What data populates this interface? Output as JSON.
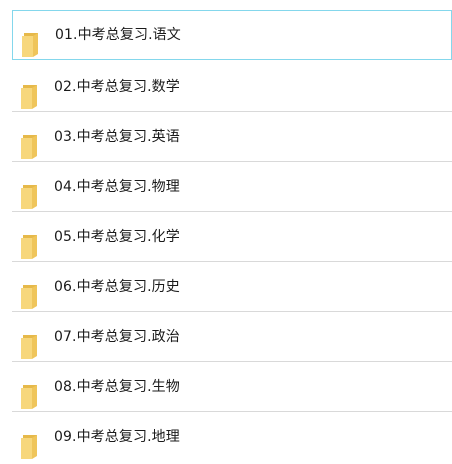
{
  "folders": [
    {
      "name": "01.中考总复习.语文",
      "selected": true
    },
    {
      "name": "02.中考总复习.数学",
      "selected": false
    },
    {
      "name": "03.中考总复习.英语",
      "selected": false
    },
    {
      "name": "04.中考总复习.物理",
      "selected": false
    },
    {
      "name": "05.中考总复习.化学",
      "selected": false
    },
    {
      "name": "06.中考总复习.历史",
      "selected": false
    },
    {
      "name": "07.中考总复习.政治",
      "selected": false
    },
    {
      "name": "08.中考总复习.生物",
      "selected": false
    },
    {
      "name": "09.中考总复习.地理",
      "selected": false
    }
  ],
  "icon": "folder-icon",
  "colors": {
    "selection_border": "#84d7ec",
    "separator": "#d9d9d9",
    "folder_back": "#e6b94a",
    "folder_front": "#f7d77c"
  }
}
